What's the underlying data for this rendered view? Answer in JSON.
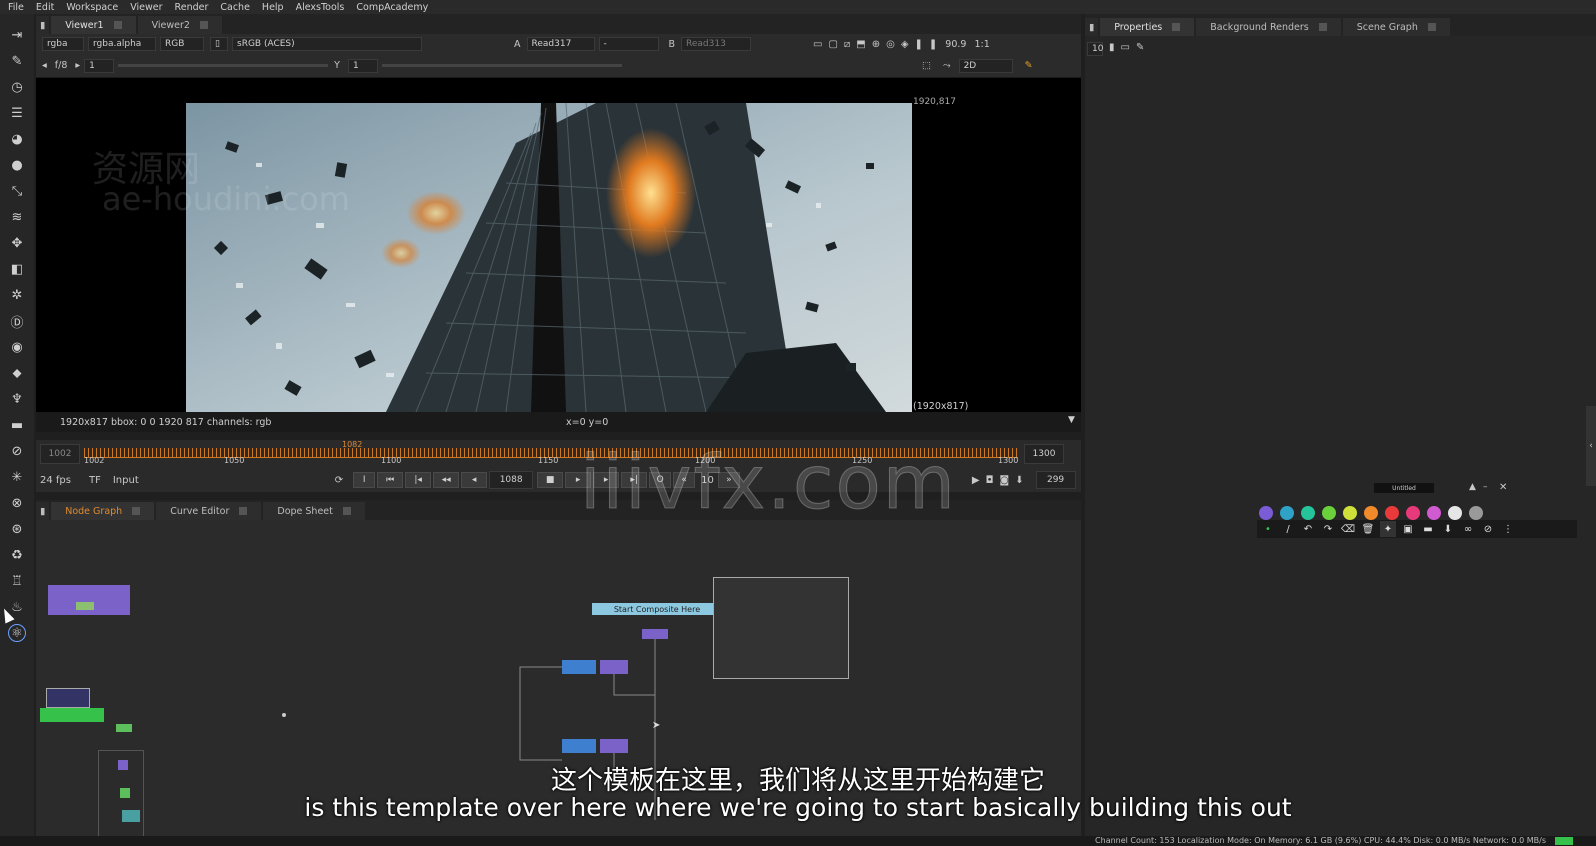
{
  "menu": [
    "File",
    "Edit",
    "Workspace",
    "Viewer",
    "Render",
    "Cache",
    "Help",
    "AlexsTools",
    "CompAcademy"
  ],
  "viewer": {
    "tabs": [
      "Viewer1",
      "Viewer2"
    ],
    "channels": "rgba",
    "alpha": "rgba.alpha",
    "mode": "RGB",
    "colorspace": "sRGB (ACES)",
    "input_a_label": "A",
    "input_a": "Read317",
    "input_a_extra": "-",
    "input_b_label": "B",
    "input_b": "Read313",
    "zoom": "90.9",
    "ratio": "1:1",
    "fstop": "f/8",
    "gain": "1",
    "gamma_label": "Y",
    "gamma": "1",
    "view_mode": "2D",
    "format_corner": "1920,817",
    "format_size": "(1920x817)",
    "status_left": "1920x817   bbox: 0 0 1920 817 channels: rgb",
    "status_center": "x=0 y=0"
  },
  "timeline": {
    "start": "1002",
    "end": "1300",
    "current": "1082",
    "ticks": [
      "1002",
      "1050",
      "1100",
      "1150",
      "1200",
      "1250",
      "1300"
    ],
    "fps": "24 fps",
    "tf": "TF",
    "input": "Input",
    "frame_field": "1088",
    "step": "10",
    "frame_count": "299"
  },
  "nodegraph": {
    "tabs": [
      "Node Graph",
      "Curve Editor",
      "Dope Sheet"
    ],
    "sticky_label": "Start Composite Here"
  },
  "right": {
    "tabs": [
      "Properties",
      "Background Renders",
      "Scene Graph"
    ],
    "count": "10",
    "palette_title": "Untitled",
    "swatch_colors": [
      "#7a5cd6",
      "#2fa3c7",
      "#26c49a",
      "#6ad03b",
      "#cfe03a",
      "#f08a2a",
      "#e83a3a",
      "#e83a7a",
      "#d05ad0",
      "#e6e6e6",
      "#9a9a9a"
    ]
  },
  "status_bar": "Channel Count: 153  Localization Mode: On  Memory: 6.1 GB (9.6%)  CPU: 44.4%  Disk: 0.0 MB/s  Network: 0.0 MB/s",
  "subtitles": {
    "chinese": "这个模板在这里，我们将从这里开始构建它",
    "english": "is this template over here where we're going to start basically building this out"
  },
  "watermarks": {
    "viewer_cn": "资源网",
    "viewer_url": "ae-houdini.com",
    "center": "iiivfx.com"
  }
}
